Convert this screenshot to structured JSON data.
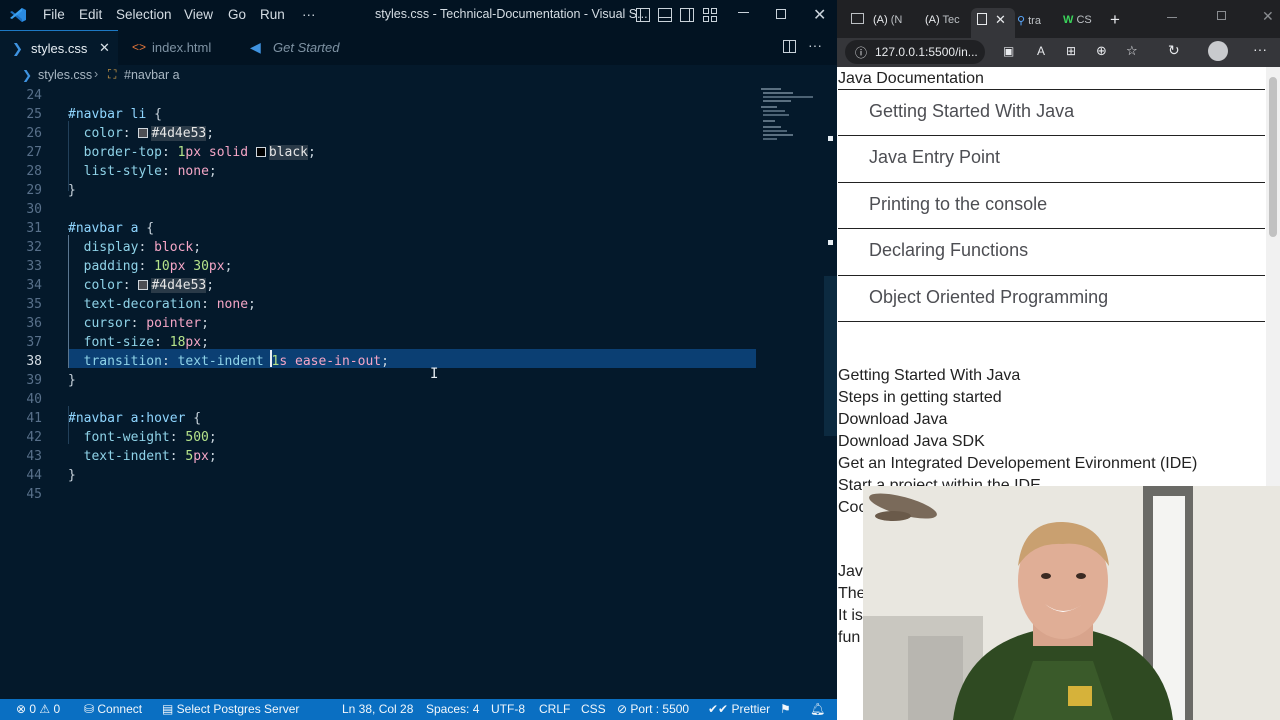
{
  "vscode": {
    "menu": [
      "File",
      "Edit",
      "Selection",
      "View",
      "Go",
      "Run",
      "···"
    ],
    "window_title": "styles.css - Technical-Documentation - Visual S...",
    "tabs": [
      {
        "label": "styles.css",
        "icon": "css-file-icon",
        "active": true
      },
      {
        "label": "index.html",
        "icon": "html-file-icon",
        "active": false
      },
      {
        "label": "Get Started",
        "icon": "vscode-icon",
        "active": false
      }
    ],
    "breadcrumb": {
      "file": "styles.css",
      "symbol": "#navbar a"
    },
    "lines": [
      {
        "n": "24",
        "html": ""
      },
      {
        "n": "25",
        "html": "<span class='sel'>#navbar li</span> {"
      },
      {
        "n": "26",
        "html": "  <span class='prop'>color</span>: <span class='sw' style='background:#4d4e53'></span><span class='hex'>#4d4e53</span>;"
      },
      {
        "n": "27",
        "html": "  <span class='prop'>border-top</span>: <span class='num'>1</span><span class='unit'>px</span> <span class='val'>solid</span> <span class='sw' style='background:#000'></span><span class='hex'>black</span>;"
      },
      {
        "n": "28",
        "html": "  <span class='prop'>list-style</span>: <span class='val'>none</span>;"
      },
      {
        "n": "29",
        "html": "}"
      },
      {
        "n": "30",
        "html": ""
      },
      {
        "n": "31",
        "html": "<span class='sel'>#navbar a</span> {"
      },
      {
        "n": "32",
        "html": "  <span class='prop'>display</span>: <span class='val'>block</span>;"
      },
      {
        "n": "33",
        "html": "  <span class='prop'>padding</span>: <span class='num'>10</span><span class='unit'>px</span> <span class='num'>30</span><span class='unit'>px</span>;"
      },
      {
        "n": "34",
        "html": "  <span class='prop'>color</span>: <span class='sw' style='background:#4d4e53'></span><span class='hex'>#4d4e53</span>;"
      },
      {
        "n": "35",
        "html": "  <span class='prop'>text-decoration</span>: <span class='val'>none</span>;"
      },
      {
        "n": "36",
        "html": "  <span class='prop'>cursor</span>: <span class='val'>pointer</span>;"
      },
      {
        "n": "37",
        "html": "  <span class='prop'>font-size</span>: <span class='num'>18</span><span class='unit'>px</span>;"
      },
      {
        "n": "38",
        "html": "  <span class='prop'>transition</span>: <span class='prop'>text-indent</span> <span class='num'>1</span><span class='unit'>s</span> <span class='val'>ease-in-out</span>;"
      },
      {
        "n": "39",
        "html": "}"
      },
      {
        "n": "40",
        "html": ""
      },
      {
        "n": "41",
        "html": "<span class='sel'>#navbar a:hover</span> {"
      },
      {
        "n": "42",
        "html": "  <span class='prop'>font-weight</span>: <span class='num'>500</span>;"
      },
      {
        "n": "43",
        "html": "  <span class='prop'>text-indent</span>: <span class='num'>5</span><span class='unit'>px</span>;"
      },
      {
        "n": "44",
        "html": "}"
      },
      {
        "n": "45",
        "html": ""
      }
    ],
    "status": {
      "errors": "0",
      "warnings": "0",
      "connect": "Connect",
      "postgres": "Select Postgres Server",
      "position": "Ln 38, Col 28",
      "spaces": "Spaces: 4",
      "encoding": "UTF-8",
      "eol": "CRLF",
      "lang": "CSS",
      "port": "Port : 5500",
      "prettier": "Prettier"
    }
  },
  "browser": {
    "tabs": [
      "(N",
      "Tec",
      "tra",
      "CS"
    ],
    "url": "127.0.0.1:5500/in...",
    "nav_title": "Java Documentation",
    "nav_items": [
      "Getting Started With Java",
      "Java Entry Point",
      "Printing to the console",
      "Declaring Functions",
      "Object Oriented Programming"
    ],
    "main_lines": [
      "Getting Started With Java",
      "Steps in getting started",
      "Download Java",
      "Download Java SDK",
      "Get an Integrated Developement Evironment (IDE)",
      "Start a project within the IDE",
      "Coc",
      "",
      "Java",
      "The",
      "It is",
      "fun"
    ]
  }
}
